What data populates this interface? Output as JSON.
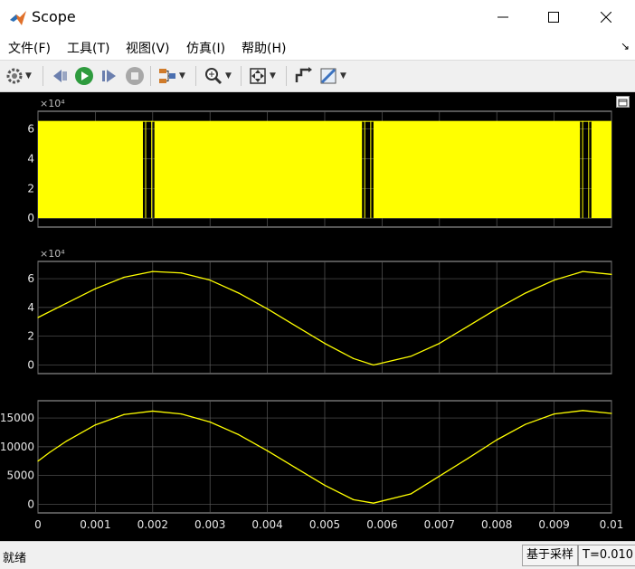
{
  "window": {
    "title": "Scope",
    "icon": "matlab-logo-icon"
  },
  "menu": {
    "items": [
      "文件(F)",
      "工具(T)",
      "视图(V)",
      "仿真(I)",
      "帮助(H)"
    ],
    "dock_icon": "dock-arrow-icon"
  },
  "toolbar": {
    "buttons": [
      "settings-icon",
      "step-back-icon",
      "run-icon",
      "step-forward-icon",
      "stop-icon",
      "signal-select-icon",
      "zoom-icon",
      "fit-axes-icon",
      "style-icon",
      "measure-icon"
    ]
  },
  "colors": {
    "trace": "#ffff00",
    "axes_bg": "#000000",
    "grid": "#5a5a5a",
    "axis_text": "#e6e6e6"
  },
  "status": {
    "left": "就绪",
    "mode": "基于采样",
    "time": "T=0.010"
  },
  "chart_data": [
    {
      "type": "line",
      "multiplier": "×10⁴",
      "ylim": [
        -0.6,
        7.2
      ],
      "yticks": [
        "0",
        "2",
        "4",
        "6"
      ],
      "xlim": [
        0,
        0.01
      ],
      "description_values": {
        "high": 6.55,
        "low": 0
      },
      "pwm_gaps": [
        [
          0.00183,
          0.00203
        ],
        [
          0.00565,
          0.00585
        ],
        [
          0.00945,
          0.00965
        ]
      ],
      "x_tick_labels_shown": false
    },
    {
      "type": "line",
      "multiplier": "×10⁴",
      "ylim": [
        -0.6,
        7.2
      ],
      "yticks": [
        "0",
        "2",
        "4",
        "6"
      ],
      "xlim": [
        0,
        0.01
      ],
      "series": [
        {
          "x": [
            0,
            0.0005,
            0.001,
            0.0015,
            0.002,
            0.0025,
            0.003,
            0.0035,
            0.004,
            0.0045,
            0.005,
            0.0055,
            0.00585,
            0.0065,
            0.007,
            0.0075,
            0.008,
            0.0085,
            0.009,
            0.0095,
            0.01
          ],
          "y": [
            3.3,
            4.3,
            5.3,
            6.1,
            6.5,
            6.4,
            5.9,
            5.0,
            3.9,
            2.7,
            1.5,
            0.45,
            0.0,
            0.6,
            1.5,
            2.7,
            3.9,
            5.0,
            5.9,
            6.5,
            6.3
          ]
        }
      ],
      "x_tick_labels_shown": false
    },
    {
      "type": "line",
      "ylim": [
        -1500,
        18000
      ],
      "yticks": [
        "0",
        "5000",
        "10000",
        "15000"
      ],
      "xlim": [
        0,
        0.01
      ],
      "xticks": [
        "0",
        "0.001",
        "0.002",
        "0.003",
        "0.004",
        "0.005",
        "0.006",
        "0.007",
        "0.008",
        "0.009",
        "0.01"
      ],
      "series": [
        {
          "x": [
            0,
            0.0002,
            0.0005,
            0.001,
            0.0015,
            0.002,
            0.0025,
            0.003,
            0.0035,
            0.004,
            0.0045,
            0.005,
            0.0055,
            0.00585,
            0.0065,
            0.007,
            0.0075,
            0.008,
            0.0085,
            0.009,
            0.0095,
            0.01
          ],
          "y": [
            7500,
            9000,
            11000,
            13800,
            15600,
            16200,
            15700,
            14300,
            12100,
            9300,
            6300,
            3300,
            800,
            200,
            1800,
            4900,
            8000,
            11200,
            13900,
            15700,
            16300,
            15800
          ]
        }
      ],
      "x_tick_labels_shown": true
    }
  ]
}
